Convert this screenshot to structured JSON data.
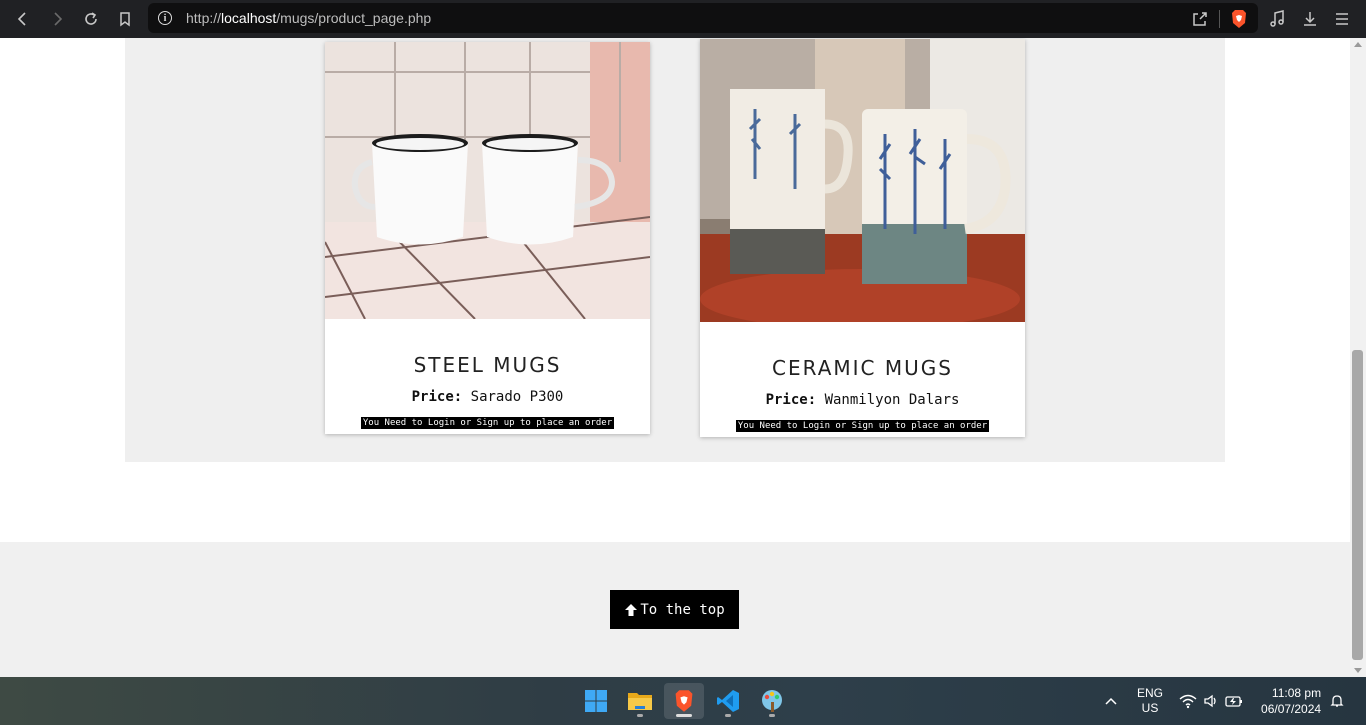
{
  "browser": {
    "url_prefix": "http://",
    "url_host": "localhost",
    "url_path": "/mugs/product_page.php"
  },
  "products": [
    {
      "title": "STEEL MUGS",
      "price_label": "Price:",
      "price_value": "Sarado P300",
      "login_note": "You Need to Login or Sign up to place an order"
    },
    {
      "title": "CERAMIC MUGS",
      "price_label": "Price:",
      "price_value": "Wanmilyon Dalars",
      "login_note": "You Need to Login or Sign up to place an order"
    }
  ],
  "footer": {
    "top_button_label": "To the top"
  },
  "taskbar": {
    "apps": [
      "start-icon",
      "file-explorer-icon",
      "brave-browser-icon",
      "vscode-icon",
      "paint-icon"
    ],
    "lang_line1": "ENG",
    "lang_line2": "US",
    "time": "11:08 pm",
    "date": "06/07/2024"
  },
  "colors": {
    "chrome": "#202124",
    "band": "#efefef",
    "footer": "#f0f0f0",
    "button": "#000000",
    "brave": "#fb542b"
  }
}
